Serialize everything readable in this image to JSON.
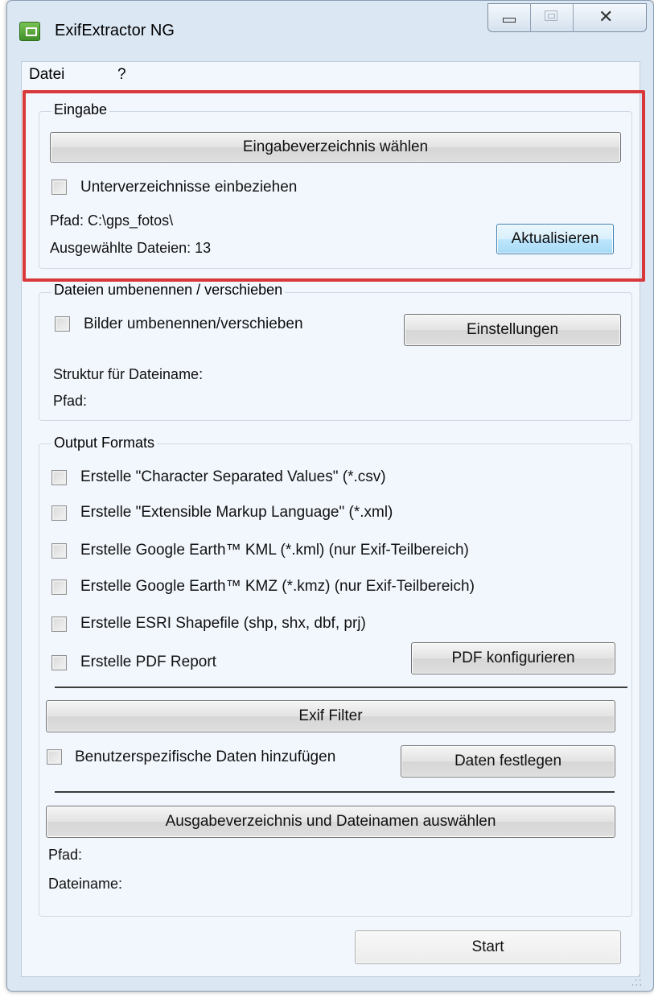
{
  "window": {
    "title": "ExifExtractor NG",
    "controls": {
      "minimize": "minimize",
      "maximize": "maximize",
      "close": "close"
    }
  },
  "menu": [
    "Datei",
    "?"
  ],
  "eingabe": {
    "legend": "Eingabe",
    "choose_dir_button": "Eingabeverzeichnis wählen",
    "subdirs_checkbox": {
      "label": "Unterverzeichnisse einbeziehen",
      "checked": false
    },
    "path_text": "Pfad: C:\\gps_fotos\\",
    "selected_files_text": "Ausgewählte Dateien: 13",
    "refresh_button": "Aktualisieren"
  },
  "rename": {
    "legend": "Dateien umbenennen / verschieben",
    "rename_checkbox": {
      "label": "Bilder umbenennen/verschieben",
      "checked": false
    },
    "settings_button": "Einstellungen",
    "structure_label": "Struktur für Dateiname:",
    "path_label": "Pfad:"
  },
  "output": {
    "legend": "Output Formats",
    "formats": [
      {
        "label": "Erstelle \"Character Separated Values\" (*.csv)",
        "checked": false
      },
      {
        "label": "Erstelle \"Extensible Markup Language\" (*.xml)",
        "checked": false
      },
      {
        "label": "Erstelle Google Earth™ KML (*.kml) (nur Exif-Teilbereich)",
        "checked": false
      },
      {
        "label": "Erstelle Google Earth™ KMZ (*.kmz) (nur Exif-Teilbereich)",
        "checked": false
      },
      {
        "label": "Erstelle ESRI Shapefile (shp, shx, dbf, prj)",
        "checked": false
      },
      {
        "label": "Erstelle PDF Report",
        "checked": false
      }
    ],
    "pdf_config_button": "PDF konfigurieren",
    "exif_filter_button": "Exif Filter",
    "custom_data_checkbox": {
      "label": "Benutzerspezifische Daten hinzufügen",
      "checked": false
    },
    "set_data_button": "Daten festlegen",
    "output_dir_button": "Ausgabeverzeichnis und Dateinamen auswählen",
    "path_label": "Pfad:",
    "filename_label": "Dateiname:"
  },
  "start_button": "Start",
  "colors": {
    "highlight": "#d9383b",
    "window_frame": "#dbe7f3",
    "client_bg": "#f2f7fd"
  }
}
